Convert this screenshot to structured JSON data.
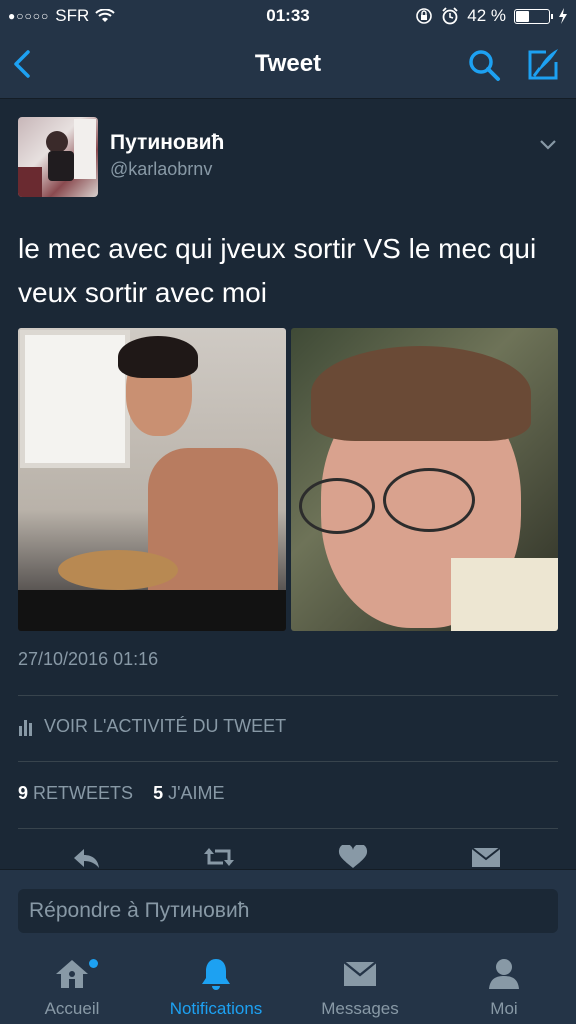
{
  "status_bar": {
    "signal": "●○○○○",
    "carrier": "SFR",
    "time": "01:33",
    "battery_percent": "42 %",
    "battery_level": 0.42
  },
  "nav": {
    "title": "Tweet"
  },
  "tweet": {
    "author_name": "Путиновић",
    "author_handle": "@karlaobrnv",
    "text": "le mec avec qui jveux sortir VS le mec qui veux sortir avec moi",
    "timestamp": "27/10/2016 01:16",
    "activity_label": "VOIR L'ACTIVITÉ DU TWEET",
    "retweets_count": "9",
    "retweets_label": "RETWEETS",
    "likes_count": "5",
    "likes_label": "J'AIME"
  },
  "reply": {
    "placeholder": "Répondre à Путиновић"
  },
  "tabs": [
    {
      "label": "Accueil",
      "icon": "home-icon"
    },
    {
      "label": "Notifications",
      "icon": "bell-icon"
    },
    {
      "label": "Messages",
      "icon": "envelope-icon"
    },
    {
      "label": "Moi",
      "icon": "person-icon"
    }
  ],
  "colors": {
    "background": "#1b2836",
    "bar": "#243447",
    "accent": "#1da1f2",
    "secondary_text": "#8899a6"
  }
}
